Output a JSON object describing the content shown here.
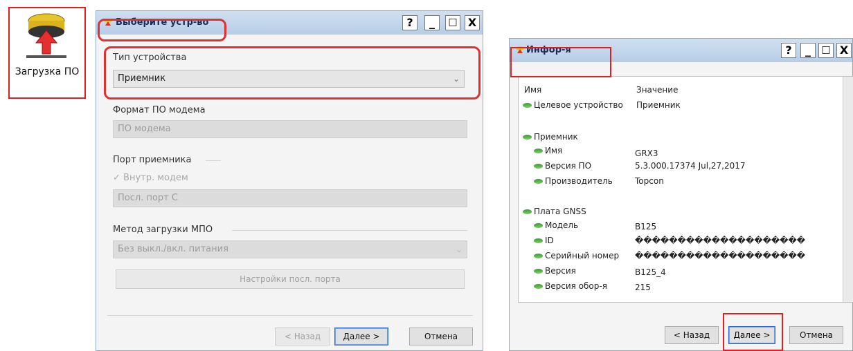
{
  "desktop_icon": {
    "label": "Загрузка ПО"
  },
  "dialog_select": {
    "title": "Выберите устр-во",
    "controls": {
      "help": "?",
      "minimize": "_",
      "maximize": "□",
      "close": "X"
    },
    "device_type": {
      "label": "Тип устройства",
      "value": "Приемник"
    },
    "modem_format": {
      "label": "Формат ПО модема",
      "value": "ПО модема"
    },
    "receiver_port": {
      "label": "Порт приемника",
      "checkbox": "Внутр. модем",
      "value": "Посл. порт C"
    },
    "upload_method": {
      "label": "Метод загрузки МПО",
      "value": "Без выкл./вкл. питания"
    },
    "serial_settings_button": "Настройки посл. порта",
    "buttons": {
      "back": "< Назад",
      "next": "Далее >",
      "cancel": "Отмена"
    }
  },
  "dialog_info": {
    "title": "Инфор-я",
    "controls": {
      "help": "?",
      "minimize": "_",
      "maximize": "□",
      "close": "X"
    },
    "columns": {
      "name": "Имя",
      "value": "Значение"
    },
    "rows": {
      "target": {
        "name": "Целевое устройство",
        "value": "Приемник"
      },
      "receiver": {
        "name": "Приемник"
      },
      "r_name": {
        "name": "Имя",
        "value": "GRX3"
      },
      "r_fw": {
        "name": "Версия ПО",
        "value": "5.3.000.17374 Jul,27,2017"
      },
      "r_mfr": {
        "name": "Производитель",
        "value": "Topcon"
      },
      "board": {
        "name": "Плата GNSS"
      },
      "b_model": {
        "name": "Модель",
        "value": "B125"
      },
      "b_id": {
        "name": "ID",
        "value": "��������������������"
      },
      "b_serial": {
        "name": "Серийный номер",
        "value": "��������������������"
      },
      "b_version": {
        "name": "Версия",
        "value": "B125_4"
      },
      "b_hw": {
        "name": "Версия обор-я",
        "value": "215"
      }
    },
    "buttons": {
      "back": "< Назад",
      "next": "Далее >",
      "cancel": "Отмена"
    }
  }
}
